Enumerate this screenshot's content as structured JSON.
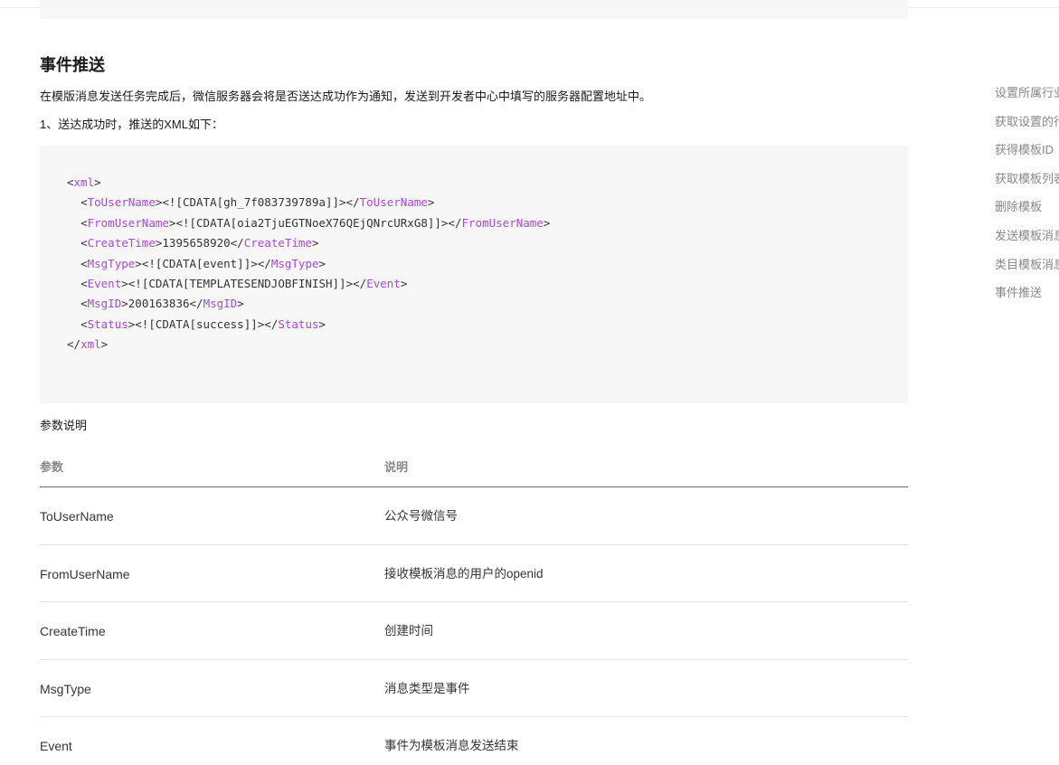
{
  "section": {
    "title": "事件推送",
    "intro": "在模版消息发送任务完成后，微信服务器会将是否送达成功作为通知，发送到开发者中心中填写的服务器配置地址中。",
    "sub_intro": "1、送达成功时，推送的XML如下："
  },
  "code": {
    "lines": [
      {
        "indent": "",
        "tag": "xml",
        "text": "",
        "close": false
      },
      {
        "indent": "  ",
        "tag": "ToUserName",
        "text": "<![CDATA[gh_7f083739789a]]>",
        "close": true
      },
      {
        "indent": "  ",
        "tag": "FromUserName",
        "text": "<![CDATA[oia2TjuEGTNoeX76QEjQNrcURxG8]]>",
        "close": true
      },
      {
        "indent": "  ",
        "tag": "CreateTime",
        "text": "1395658920",
        "close": true
      },
      {
        "indent": "  ",
        "tag": "MsgType",
        "text": "<![CDATA[event]]>",
        "close": true
      },
      {
        "indent": "  ",
        "tag": "Event",
        "text": "<![CDATA[TEMPLATESENDJOBFINISH]]>",
        "close": true
      },
      {
        "indent": "  ",
        "tag": "MsgID",
        "text": "200163836",
        "close": true
      },
      {
        "indent": "  ",
        "tag": "Status",
        "text": "<![CDATA[success]]>",
        "close": true
      },
      {
        "indent": "",
        "tag": "xml",
        "text": "",
        "close": false,
        "closing_only": true
      }
    ]
  },
  "params": {
    "caption": "参数说明",
    "headers": {
      "param": "参数",
      "desc": "说明"
    },
    "rows": [
      {
        "param": "ToUserName",
        "desc": "公众号微信号"
      },
      {
        "param": "FromUserName",
        "desc": "接收模板消息的用户的openid"
      },
      {
        "param": "CreateTime",
        "desc": "创建时间"
      },
      {
        "param": "MsgType",
        "desc": "消息类型是事件"
      },
      {
        "param": "Event",
        "desc": "事件为模板消息发送结束"
      }
    ]
  },
  "toc": {
    "items": [
      "设置所属行业",
      "获取设置的行业信息",
      "获得模板ID",
      "获取模板列表",
      "删除模板",
      "发送模板消息",
      "类目模板消息",
      "事件推送"
    ]
  },
  "colors": {
    "code_tag": "#a54bd1",
    "code_bg": "#f7f7f7",
    "muted_text": "#888888"
  }
}
